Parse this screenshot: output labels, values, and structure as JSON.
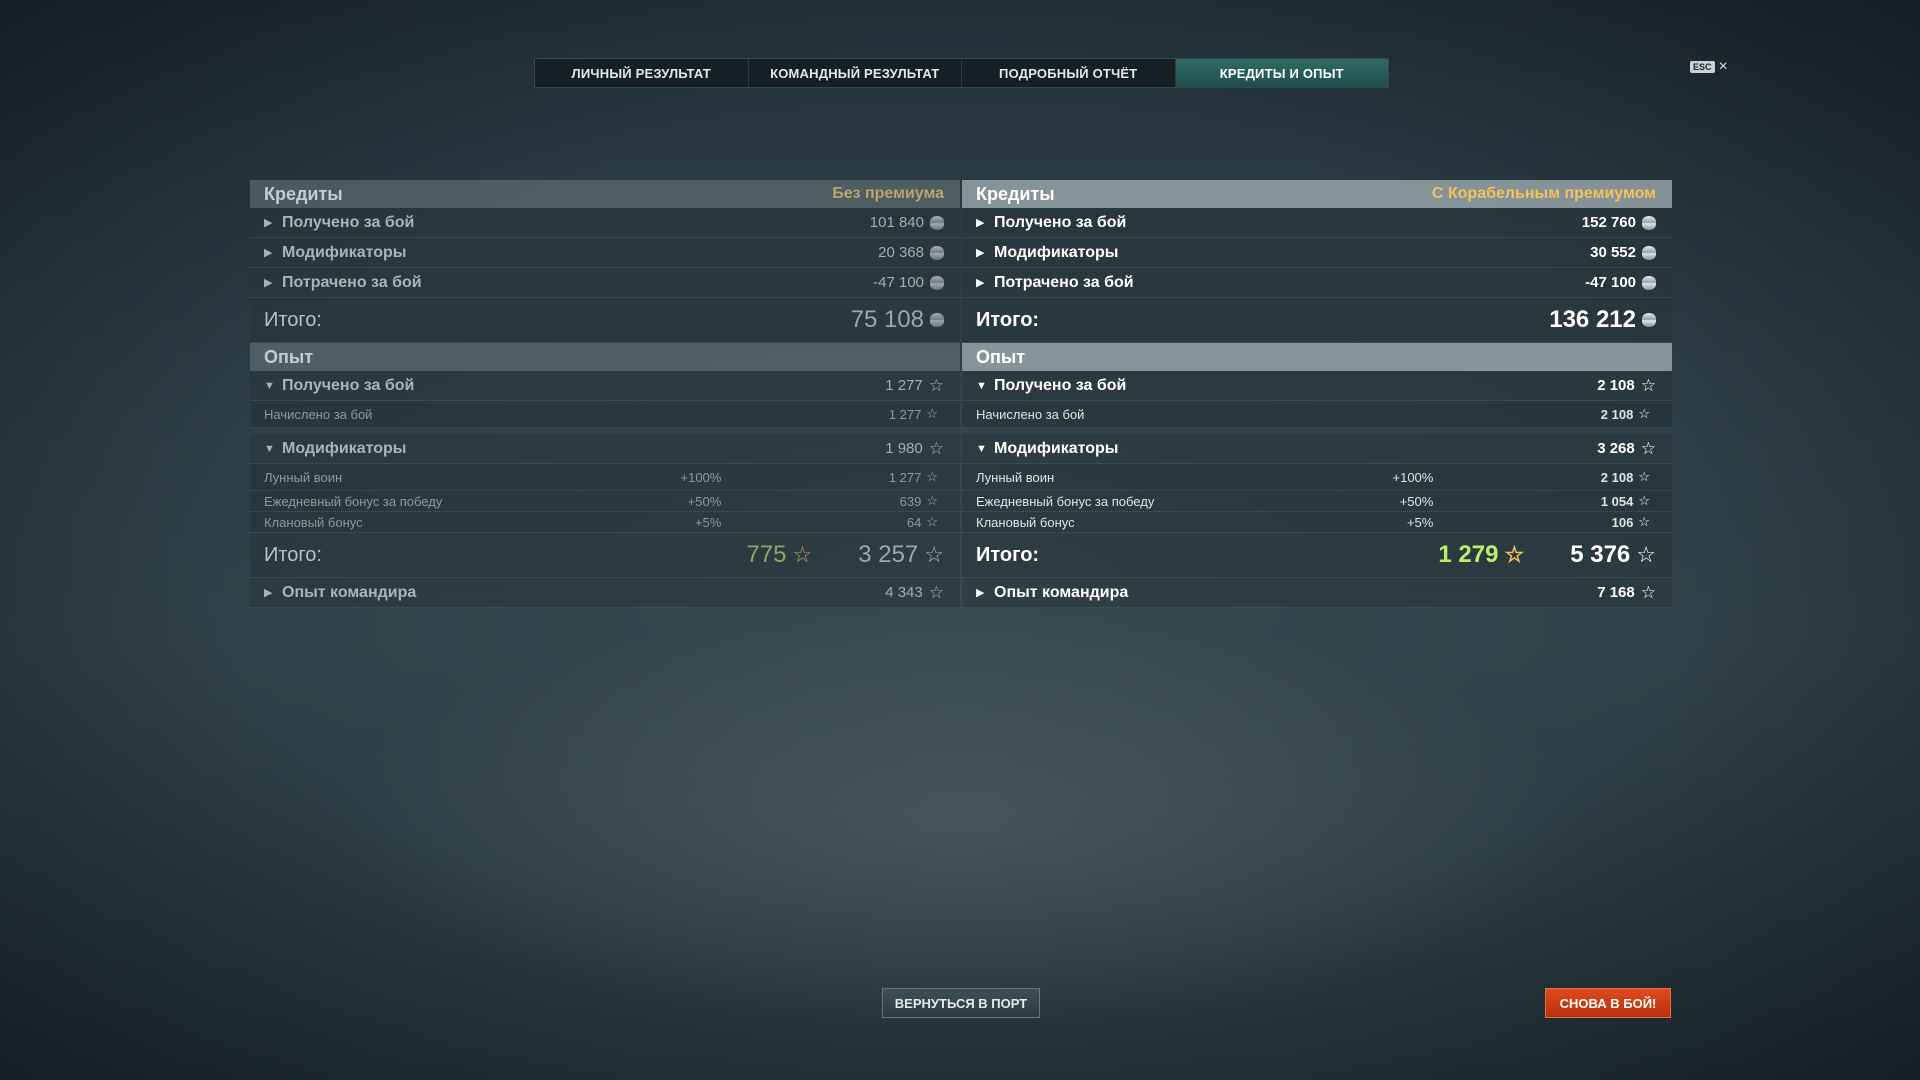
{
  "tabs": [
    {
      "label": "ЛИЧНЫЙ РЕЗУЛЬТАТ"
    },
    {
      "label": "КОМАНДНЫЙ РЕЗУЛЬТАТ"
    },
    {
      "label": "ПОДРОБНЫЙ ОТЧЁТ"
    },
    {
      "label": "КРЕДИТЫ И ОПЫТ",
      "active": true
    }
  ],
  "esc": {
    "badge": "ESC",
    "close": "×"
  },
  "left": {
    "credits_title": "Кредиты",
    "credits_tag": "Без премиума",
    "credits_rows": [
      {
        "label": "Получено за бой",
        "value": "101 840"
      },
      {
        "label": "Модификаторы",
        "value": "20 368"
      },
      {
        "label": "Потрачено за бой",
        "value": "-47 100"
      }
    ],
    "credits_total_label": "Итого:",
    "credits_total": "75 108",
    "xp_title": "Опыт",
    "xp_earned": {
      "label": "Получено за бой",
      "value": "1 277"
    },
    "xp_earned_sub": {
      "label": "Начислено за бой",
      "value": "1 277"
    },
    "xp_mods": {
      "label": "Модификаторы",
      "value": "1 980"
    },
    "xp_mods_sub": [
      {
        "label": "Лунный воин",
        "pct": "+100%",
        "value": "1 277"
      },
      {
        "label": "Ежедневный бонус за победу",
        "pct": "+50%",
        "value": "639"
      },
      {
        "label": "Клановый бонус",
        "pct": "+5%",
        "value": "64"
      }
    ],
    "xp_total_label": "Итого:",
    "xp_total_bonus": "775",
    "xp_total": "3 257",
    "commander": {
      "label": "Опыт командира",
      "value": "4 343"
    }
  },
  "right": {
    "credits_title": "Кредиты",
    "credits_tag": "С Корабельным премиумом",
    "credits_rows": [
      {
        "label": "Получено за бой",
        "value": "152 760"
      },
      {
        "label": "Модификаторы",
        "value": "30 552"
      },
      {
        "label": "Потрачено за бой",
        "value": "-47 100"
      }
    ],
    "credits_total_label": "Итого:",
    "credits_total": "136 212",
    "xp_title": "Опыт",
    "xp_earned": {
      "label": "Получено за бой",
      "value": "2 108"
    },
    "xp_earned_sub": {
      "label": "Начислено за бой",
      "value": "2 108"
    },
    "xp_mods": {
      "label": "Модификаторы",
      "value": "3 268"
    },
    "xp_mods_sub": [
      {
        "label": "Лунный воин",
        "pct": "+100%",
        "value": "2 108"
      },
      {
        "label": "Ежедневный бонус за победу",
        "pct": "+50%",
        "value": "1 054"
      },
      {
        "label": "Клановый бонус",
        "pct": "+5%",
        "value": "106"
      }
    ],
    "xp_total_label": "Итого:",
    "xp_total_bonus": "1 279",
    "xp_total": "5 376",
    "commander": {
      "label": "Опыт командира",
      "value": "7 168"
    }
  },
  "buttons": {
    "port": "ВЕРНУТЬСЯ В ПОРТ",
    "battle": "СНОВА В БОЙ!"
  },
  "icons": {
    "credits": "credit-coin-icon",
    "xp": "star-icon",
    "expand": "triangle-right",
    "collapse": "triangle-down"
  },
  "colors": {
    "active_tab": "#2f6a66",
    "premium_tag": "#f2c25c",
    "bonus_xp": "#b8f06a",
    "battle_button": "#d63e14"
  }
}
